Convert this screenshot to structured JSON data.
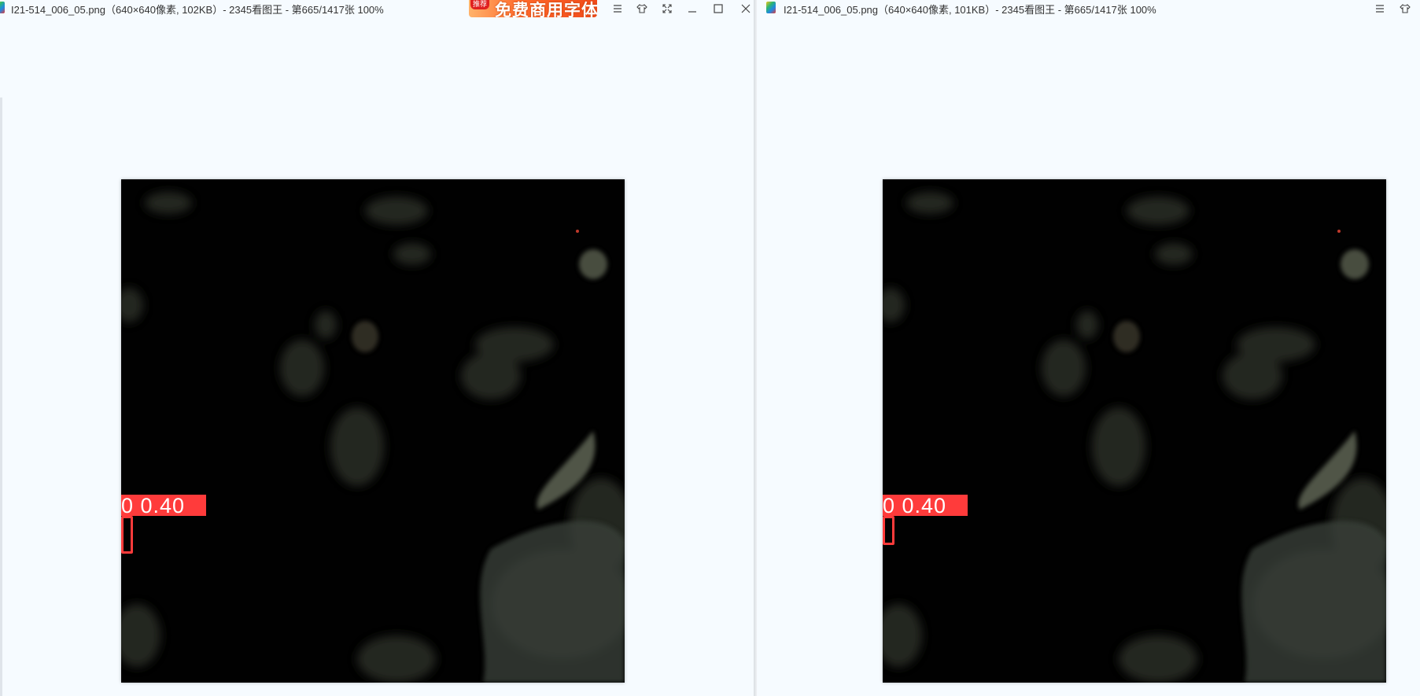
{
  "windows": [
    {
      "title": "I21-514_006_05.png（640×640像素, 102KB）- 2345看图王 - 第665/1417张 100%",
      "ad": {
        "tag": "推荐",
        "text": "免费商用字体"
      },
      "detection": {
        "label": "0  0.40"
      }
    },
    {
      "title": "I21-514_006_05.png（640×640像素, 101KB）- 2345看图王 - 第665/1417张 100%",
      "detection": {
        "label": "0  0.40"
      }
    }
  ],
  "colors": {
    "detection": "#ff3b3b",
    "window_bg": "#f6fbff",
    "image_bg": "#010101"
  },
  "icons": [
    "menu-icon",
    "skin-icon",
    "fullscreen-icon",
    "minimize-icon",
    "maximize-icon",
    "close-icon"
  ]
}
